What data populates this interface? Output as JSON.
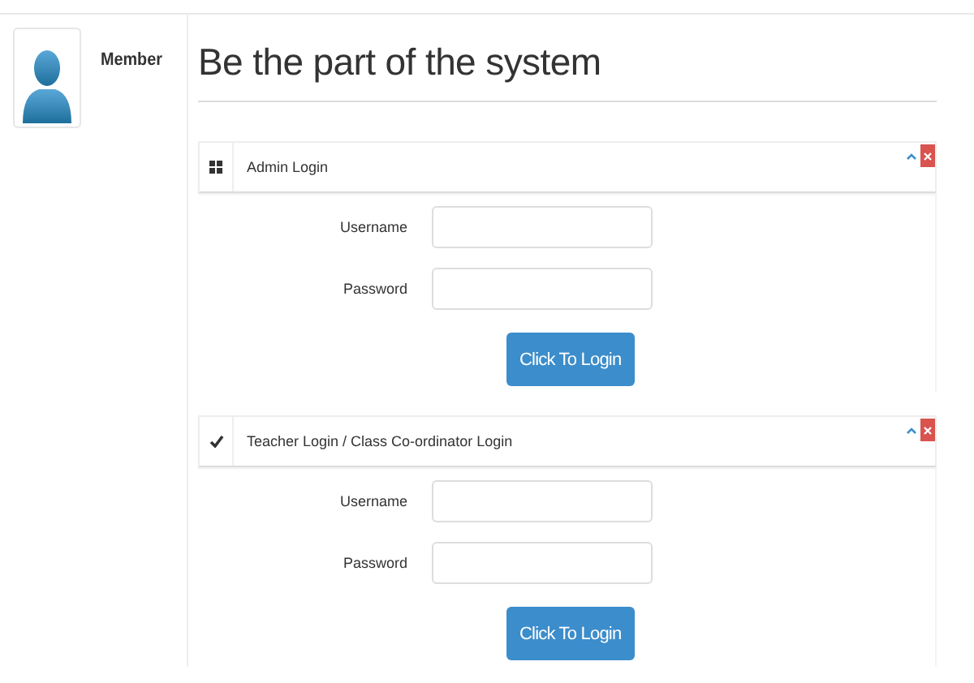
{
  "profile": {
    "label": "Member"
  },
  "heading": "Be the part of the system",
  "panels": [
    {
      "title": "Admin Login",
      "kind": "grid",
      "fields": [
        {
          "label": "Username"
        },
        {
          "label": "Password"
        }
      ],
      "button": "Click To Login"
    },
    {
      "title": "Teacher Login / Class Co-ordinator Login",
      "kind": "check",
      "fields": [
        {
          "label": "Username"
        },
        {
          "label": "Password"
        }
      ],
      "button": "Click To Login"
    }
  ]
}
